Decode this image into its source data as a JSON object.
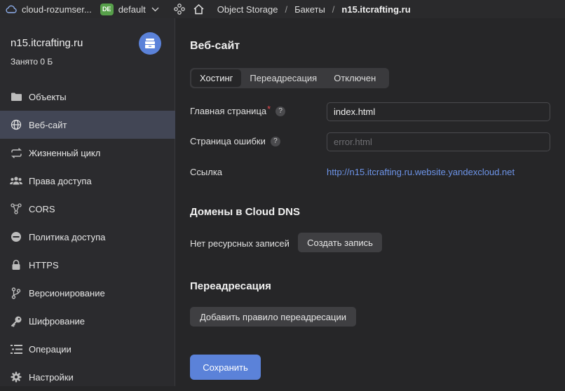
{
  "topbar": {
    "cloud_name": "cloud-rozumser...",
    "folder_badge": "DE",
    "folder_name": "default",
    "breadcrumb": [
      "Object Storage",
      "Бакеты",
      "n15.itcrafting.ru"
    ]
  },
  "bucket": {
    "name": "n15.itcrafting.ru",
    "size": "Занято 0 Б"
  },
  "sidebar": {
    "items": [
      {
        "label": "Объекты",
        "icon": "folder-icon"
      },
      {
        "label": "Веб-сайт",
        "icon": "globe-icon",
        "active": true
      },
      {
        "label": "Жизненный цикл",
        "icon": "lifecycle-icon"
      },
      {
        "label": "Права доступа",
        "icon": "users-icon"
      },
      {
        "label": "CORS",
        "icon": "cors-icon"
      },
      {
        "label": "Политика доступа",
        "icon": "policy-icon"
      },
      {
        "label": "HTTPS",
        "icon": "lock-icon"
      },
      {
        "label": "Версионирование",
        "icon": "versioning-icon"
      },
      {
        "label": "Шифрование",
        "icon": "key-icon"
      },
      {
        "label": "Операции",
        "icon": "operations-icon"
      },
      {
        "label": "Настройки",
        "icon": "gear-icon"
      }
    ]
  },
  "main": {
    "title": "Веб-сайт",
    "tabs": [
      "Хостинг",
      "Переадресация",
      "Отключен"
    ],
    "active_tab": "Хостинг",
    "index_label": "Главная страница",
    "index_required_mark": "*",
    "index_value": "index.html",
    "error_label": "Страница ошибки",
    "error_placeholder": "error.html",
    "link_label": "Ссылка",
    "link_value": "http://n15.itcrafting.ru.website.yandexcloud.net",
    "help_mark": "?",
    "dns_title": "Домены в Cloud DNS",
    "dns_empty": "Нет ресурсных записей",
    "dns_create_button": "Создать запись",
    "redirect_title": "Переадресация",
    "redirect_add_button": "Добавить правило переадресации",
    "save_button": "Сохранить"
  },
  "colors": {
    "accent": "#5b82d9",
    "link": "#6d94e8",
    "badge": "#57a04a",
    "required": "#e5484d"
  }
}
